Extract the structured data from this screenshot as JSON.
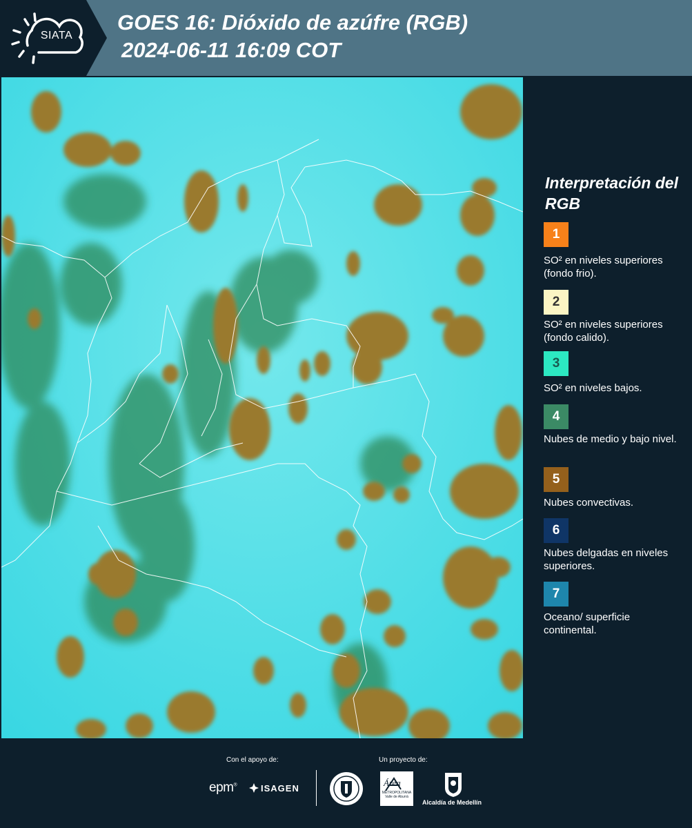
{
  "header": {
    "logo_text": "SIATA",
    "title_line1": "GOES 16: Dióxido de azúfre (RGB)",
    "title_line2": "2024-06-11 16:09 COT"
  },
  "colors": {
    "header_bg": "#4f7486",
    "panel_bg": "#0d1f2c",
    "surface_cyan": "#40dce4",
    "cloud_brown": "#9a7a2e",
    "cloud_green": "#2f8a5a"
  },
  "legend": {
    "title": "Interpretación del RGB",
    "items": [
      {
        "number": "1",
        "color": "#f7811a",
        "text_color": "#ffffff",
        "text": "SO² en niveles superiores (fondo frio)."
      },
      {
        "number": "2",
        "color": "#fbf5c4",
        "text_color": "#333333",
        "text": "SO² en niveles superiores (fondo calido)."
      },
      {
        "number": "3",
        "color": "#2ce8c2",
        "text_color": "#1a5a50",
        "text": "SO² en niveles bajos."
      },
      {
        "number": "4",
        "color": "#3b8a65",
        "text_color": "#ffffff",
        "text": "Nubes de medio y bajo nivel."
      },
      {
        "number": "5",
        "color": "#94601c",
        "text_color": "#ffffff",
        "text": "Nubes convectivas."
      },
      {
        "number": "6",
        "color": "#0f3566",
        "text_color": "#ffffff",
        "text": "Nubes delgadas en niveles superiores."
      },
      {
        "number": "7",
        "color": "#1e86ac",
        "text_color": "#ffffff",
        "text": "Oceano/ superficie continental."
      }
    ]
  },
  "footer": {
    "support_label": "Con el apoyo de:",
    "project_label": "Un proyecto de:",
    "sponsors": {
      "epm": "epm",
      "isagen": "ISAGEN",
      "metropolitana_name": "Área",
      "metropolitana_line1": "METROPOLITANA",
      "metropolitana_line2": "Valle de Aburrá",
      "alcaldia": "Alcaldía de Medellín"
    }
  }
}
